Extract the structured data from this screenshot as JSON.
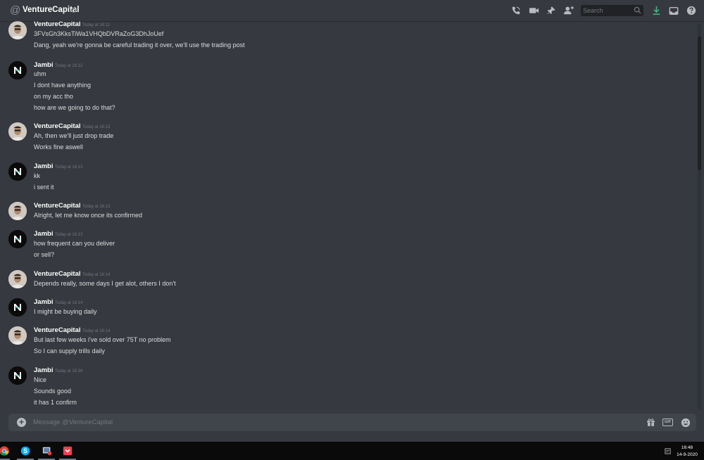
{
  "header": {
    "title": "VentureCapital",
    "search_placeholder": "Search"
  },
  "messages": [
    {
      "author": "VentureCapital",
      "avatar": "venturecapital-avatar",
      "timestamp": "Today at 16:11",
      "lines": [
        "3FVsGh3KksTiWa1VHQbDVRaZoG3DhJoUef",
        "Dang, yeah we're gonna be careful trading it over, we'll use the trading post"
      ]
    },
    {
      "author": "Jambi",
      "avatar": "jambi-avatar",
      "timestamp": "Today at 16:12",
      "lines": [
        "uhm",
        "I dont have anything",
        "on my acc tho",
        "how are we going to do that?"
      ]
    },
    {
      "author": "VentureCapital",
      "avatar": "venturecapital-avatar",
      "timestamp": "Today at 16:13",
      "lines": [
        "Ah, then we'll just drop trade",
        "Works fine aswell"
      ]
    },
    {
      "author": "Jambi",
      "avatar": "jambi-avatar",
      "timestamp": "Today at 16:13",
      "lines": [
        "kk",
        "i sent it"
      ]
    },
    {
      "author": "VentureCapital",
      "avatar": "venturecapital-avatar",
      "timestamp": "Today at 16:13",
      "lines": [
        "Alright, let me know once its confirmed"
      ]
    },
    {
      "author": "Jambi",
      "avatar": "jambi-avatar",
      "timestamp": "Today at 16:13",
      "lines": [
        "how frequent can you deliver",
        "or sell?"
      ]
    },
    {
      "author": "VentureCapital",
      "avatar": "venturecapital-avatar",
      "timestamp": "Today at 16:14",
      "lines": [
        "Depends really, some days I get alot, others I don't"
      ]
    },
    {
      "author": "Jambi",
      "avatar": "jambi-avatar",
      "timestamp": "Today at 16:14",
      "lines": [
        "I might be buying daily"
      ]
    },
    {
      "author": "VentureCapital",
      "avatar": "venturecapital-avatar",
      "timestamp": "Today at 16:14",
      "lines": [
        "But last few weeks i've sold over 75T no problem",
        "So I can supply trills daily"
      ]
    },
    {
      "author": "Jambi",
      "avatar": "jambi-avatar",
      "timestamp": "Today at 16:34",
      "lines": [
        "Nice",
        "Sounds good",
        "it has 1 confirm"
      ]
    }
  ],
  "composer": {
    "placeholder": "Message @VentureCapital",
    "gif_label": "GIF"
  },
  "taskbar": {
    "apps": [
      "chrome-icon",
      "skype-icon",
      "snipping-tool-icon",
      "pocket-icon"
    ],
    "time": "16:48",
    "date": "14-9-2020"
  },
  "colors": {
    "background": "#36393f",
    "header_text": "#ffffff",
    "message_text": "#dcddde",
    "timestamp": "#72767d",
    "input_bg": "#40444b",
    "download_icon": "#43b581"
  }
}
